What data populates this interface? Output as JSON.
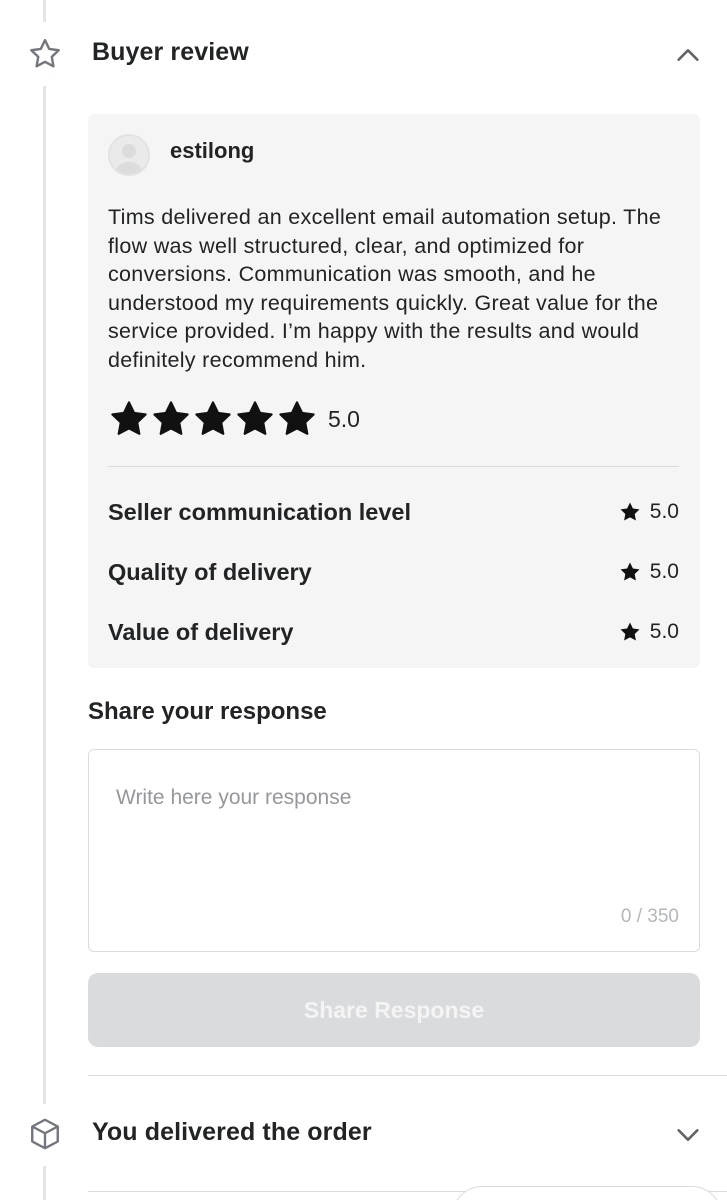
{
  "buyer_review_section": {
    "title": "Buyer review",
    "icon": "star-outline-icon",
    "state": "expanded"
  },
  "review": {
    "reviewer_name": "estilong",
    "text": "Tims delivered an excellent email automation setup. The flow was well structured, clear, and optimized for conversions. Communication was smooth, and he understood my requirements quickly. Great value for the service provided. I’m happy with the results and would definitely recommend him.",
    "overall_rating": 5,
    "overall_rating_label": "5.0",
    "criteria": [
      {
        "label": "Seller communication level",
        "score": "5.0"
      },
      {
        "label": "Quality of delivery",
        "score": "5.0"
      },
      {
        "label": "Value of delivery",
        "score": "5.0"
      }
    ]
  },
  "response": {
    "title": "Share your response",
    "placeholder": "Write here your response",
    "value": "",
    "counter": "0 / 350",
    "button_label": "Share Response",
    "button_enabled": false
  },
  "delivered_section": {
    "title": "You delivered the order",
    "icon": "box-icon",
    "state": "collapsed"
  },
  "colors": {
    "text": "#222325",
    "card_bg": "#f5f5f5",
    "rail": "#e4e5e7",
    "disabled_button": "#dadbdd",
    "placeholder": "#95979d"
  }
}
